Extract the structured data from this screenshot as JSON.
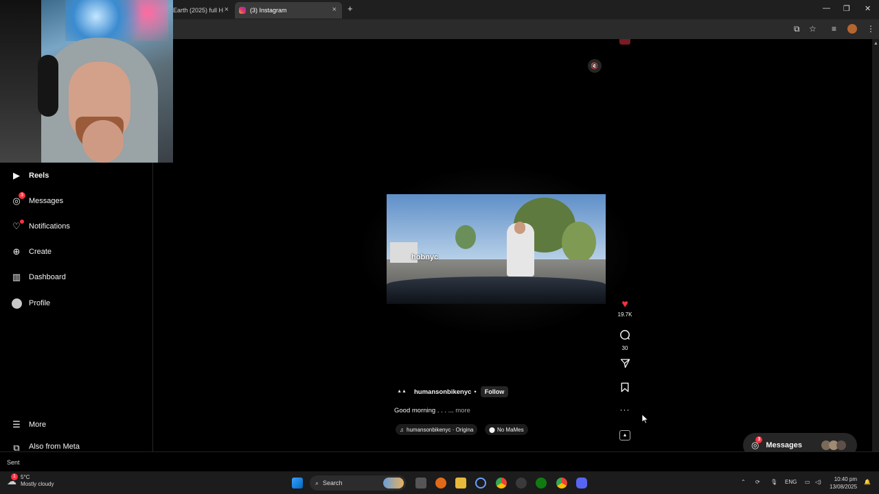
{
  "browser": {
    "tabs": [
      {
        "label": "Earth (2025) full H",
        "active": false
      },
      {
        "label": "(3) Instagram",
        "active": true
      }
    ],
    "new_tab_icon": "plus-icon"
  },
  "sidebar": {
    "items": [
      {
        "label": "Reels",
        "icon": "reels-icon"
      },
      {
        "label": "Messages",
        "icon": "messenger-icon",
        "badge": "3"
      },
      {
        "label": "Notifications",
        "icon": "heart-icon",
        "dot": true
      },
      {
        "label": "Create",
        "icon": "plus-square-icon"
      },
      {
        "label": "Dashboard",
        "icon": "chart-icon"
      },
      {
        "label": "Profile",
        "icon": "avatar"
      }
    ],
    "more_label": "More",
    "meta_label": "Also from Meta"
  },
  "reel": {
    "watermark": "hobnyc",
    "likes": "19.7K",
    "comments": "30",
    "author": "humansonbikenyc",
    "separator": "•",
    "follow_label": "Follow",
    "caption": "Good morning . . . ...",
    "more_label": "more",
    "audio": "humansonbikenyc · Origina",
    "location": "No MaMes",
    "accent": "#ff3040"
  },
  "messages_pill": {
    "label": "Messages",
    "badge": "3"
  },
  "status_bar": {
    "text": "Sent"
  },
  "taskbar": {
    "weather_temp": "5°C",
    "weather_desc": "Mostly cloudy",
    "weather_badge": "1",
    "search_label": "Search",
    "lang": "ENG",
    "time": "10:40 pm",
    "date": "13/08/2025"
  }
}
